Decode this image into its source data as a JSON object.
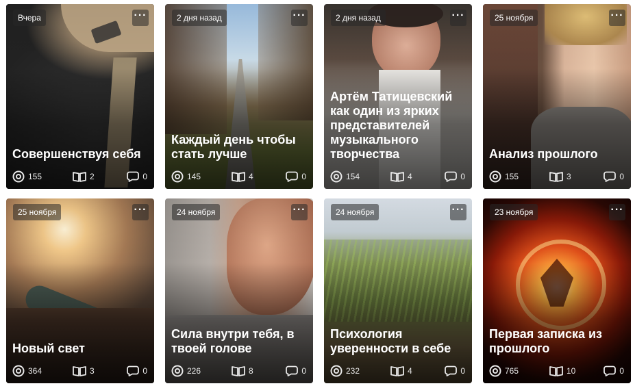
{
  "cards": [
    {
      "date": "Вчера",
      "title": "Совершенствуя себя",
      "views": "155",
      "reads": "2",
      "comments": "0"
    },
    {
      "date": "2 дня назад",
      "title": "Каждый день чтобы стать лучше",
      "views": "145",
      "reads": "4",
      "comments": "0"
    },
    {
      "date": "2 дня назад",
      "title": "Артём Татищевский как один из ярких представителей музыкального творчества",
      "views": "154",
      "reads": "4",
      "comments": "0"
    },
    {
      "date": "25 ноября",
      "title": "Анализ прошлого",
      "views": "155",
      "reads": "3",
      "comments": "0"
    },
    {
      "date": "25 ноября",
      "title": "Новый свет",
      "views": "364",
      "reads": "3",
      "comments": "0"
    },
    {
      "date": "24 ноября",
      "title": "Сила внутри тебя, в твоей голове",
      "views": "226",
      "reads": "8",
      "comments": "0"
    },
    {
      "date": "24 ноября",
      "title": "Психология уверенности в себе",
      "views": "232",
      "reads": "4",
      "comments": "0"
    },
    {
      "date": "23 ноября",
      "title": "Первая записка из прошлого",
      "views": "765",
      "reads": "10",
      "comments": "0"
    }
  ],
  "icons": {
    "views": "eye-ring-icon",
    "reads": "open-book-icon",
    "comments": "speech-bubble-icon",
    "more": "more-dots-icon"
  }
}
